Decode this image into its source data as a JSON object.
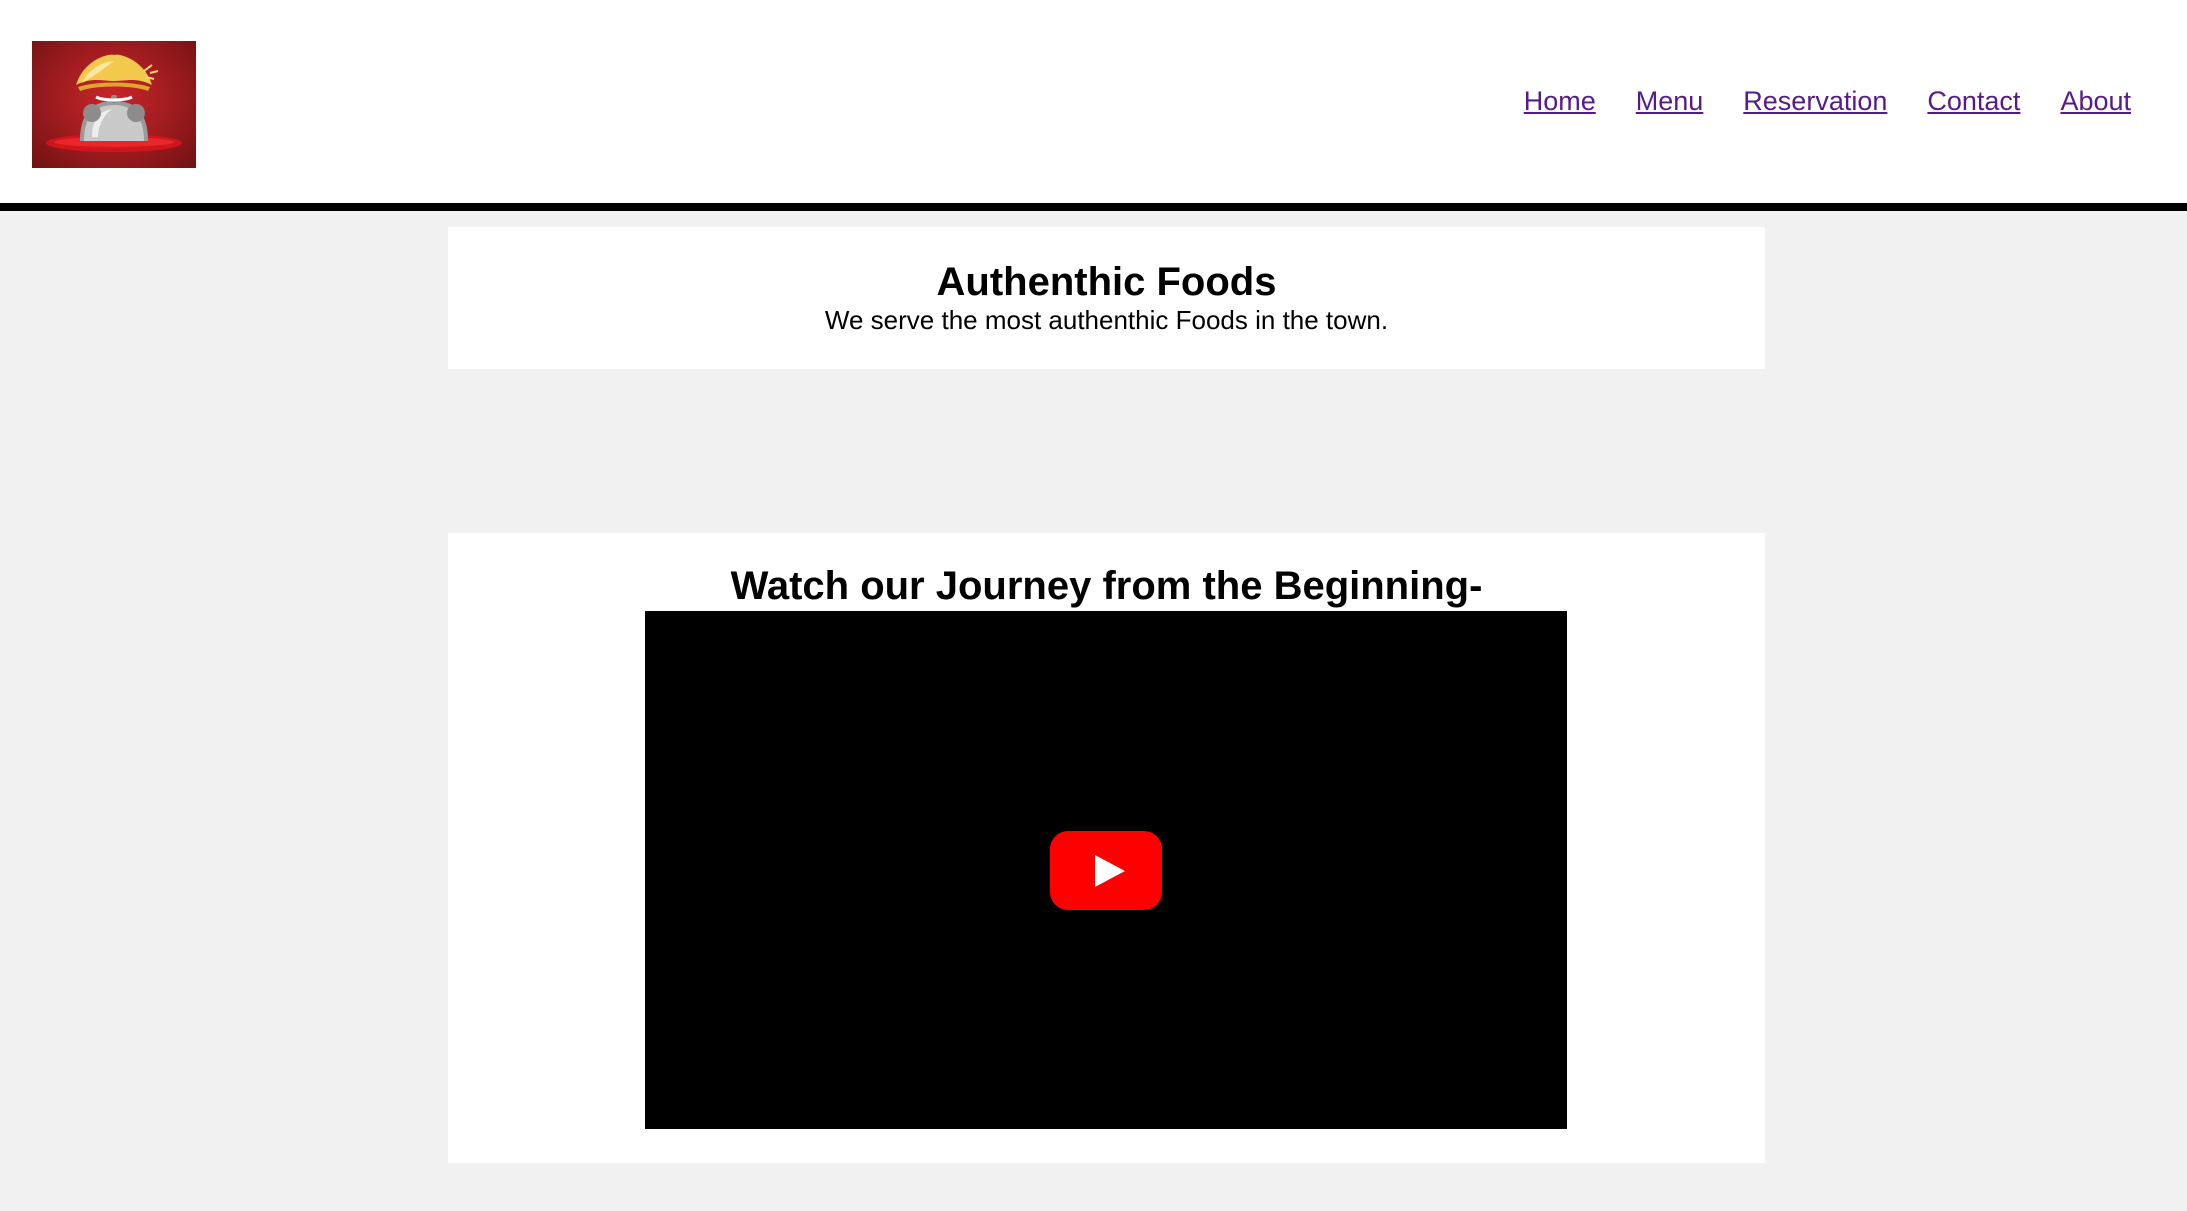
{
  "header": {
    "logo_icon": "restaurant-cloche-chef-hat-logo",
    "nav": {
      "home": "Home",
      "menu": "Menu",
      "reservation": "Reservation",
      "contact": "Contact",
      "about": "About"
    },
    "link_color": "#551a8b"
  },
  "hero": {
    "title": "Authenthic Foods",
    "subtitle": "We serve the most authenthic Foods in the town."
  },
  "video_section": {
    "title": "Watch our Journey from the Beginning-",
    "play_icon": "youtube-play-icon",
    "play_color": "#ff0000"
  }
}
